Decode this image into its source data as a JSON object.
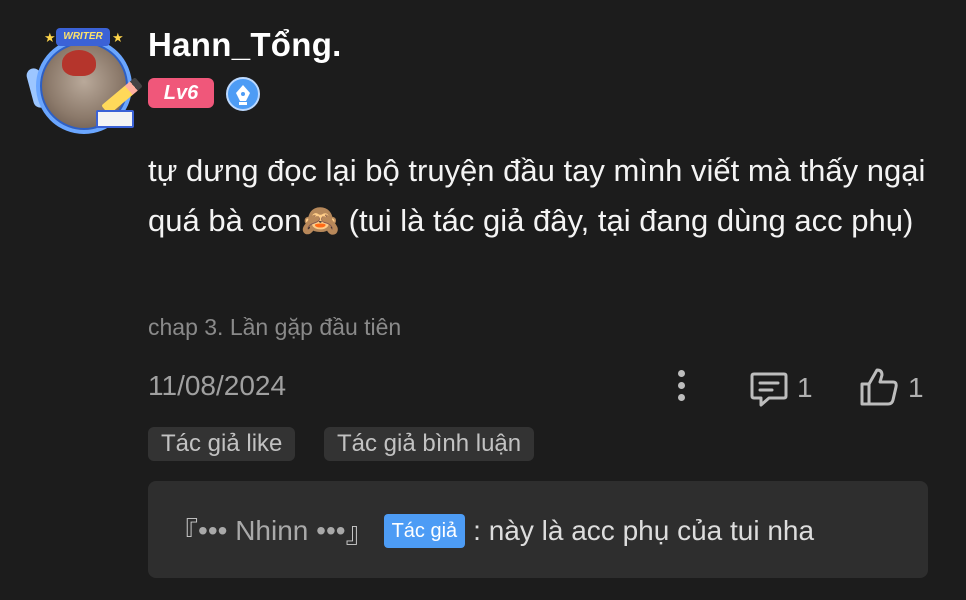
{
  "colors": {
    "background": "#1c1c1c",
    "level_badge": "#f0577a",
    "writer_badge": "#4d9cf5",
    "author_chip": "#4d9cf5",
    "tag_bg": "#333333",
    "reply_bg": "#2e2e2e"
  },
  "comment": {
    "avatar_banner": "WRITER",
    "username": "Hann_Tổng.",
    "level": "Lv6",
    "writer_badge_icon": "pen-nib-icon",
    "content": "tự dưng đọc lại bộ truyện đầu tay mình viết mà thấy ngại quá bà con🙈 (tui là tác giả đây, tại đang dùng acc phụ)",
    "chapter": "chap 3. Lần gặp đầu tiên",
    "date": "11/08/2024",
    "comment_count": "1",
    "like_count": "1",
    "tags": [
      "Tác giả like",
      "Tác giả bình luận"
    ]
  },
  "reply": {
    "open_bracket": "『",
    "author": "••• Nhinn •••",
    "close_bracket": "』",
    "author_chip": "Tác giả",
    "text": ": này là acc phụ của tui nha"
  }
}
